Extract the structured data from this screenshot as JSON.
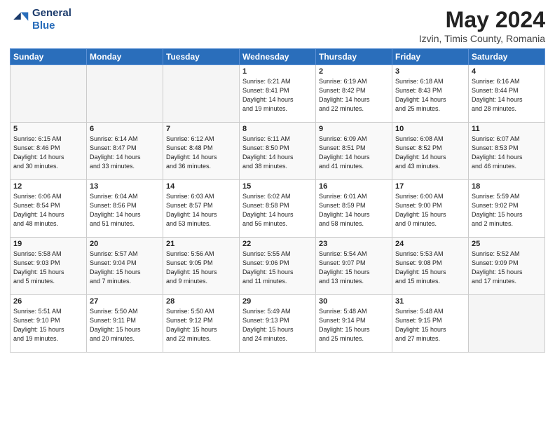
{
  "header": {
    "logo_line1": "General",
    "logo_line2": "Blue",
    "month_year": "May 2024",
    "location": "Izvin, Timis County, Romania"
  },
  "days_of_week": [
    "Sunday",
    "Monday",
    "Tuesday",
    "Wednesday",
    "Thursday",
    "Friday",
    "Saturday"
  ],
  "weeks": [
    [
      {
        "day": "",
        "info": ""
      },
      {
        "day": "",
        "info": ""
      },
      {
        "day": "",
        "info": ""
      },
      {
        "day": "1",
        "info": "Sunrise: 6:21 AM\nSunset: 8:41 PM\nDaylight: 14 hours\nand 19 minutes."
      },
      {
        "day": "2",
        "info": "Sunrise: 6:19 AM\nSunset: 8:42 PM\nDaylight: 14 hours\nand 22 minutes."
      },
      {
        "day": "3",
        "info": "Sunrise: 6:18 AM\nSunset: 8:43 PM\nDaylight: 14 hours\nand 25 minutes."
      },
      {
        "day": "4",
        "info": "Sunrise: 6:16 AM\nSunset: 8:44 PM\nDaylight: 14 hours\nand 28 minutes."
      }
    ],
    [
      {
        "day": "5",
        "info": "Sunrise: 6:15 AM\nSunset: 8:46 PM\nDaylight: 14 hours\nand 30 minutes."
      },
      {
        "day": "6",
        "info": "Sunrise: 6:14 AM\nSunset: 8:47 PM\nDaylight: 14 hours\nand 33 minutes."
      },
      {
        "day": "7",
        "info": "Sunrise: 6:12 AM\nSunset: 8:48 PM\nDaylight: 14 hours\nand 36 minutes."
      },
      {
        "day": "8",
        "info": "Sunrise: 6:11 AM\nSunset: 8:50 PM\nDaylight: 14 hours\nand 38 minutes."
      },
      {
        "day": "9",
        "info": "Sunrise: 6:09 AM\nSunset: 8:51 PM\nDaylight: 14 hours\nand 41 minutes."
      },
      {
        "day": "10",
        "info": "Sunrise: 6:08 AM\nSunset: 8:52 PM\nDaylight: 14 hours\nand 43 minutes."
      },
      {
        "day": "11",
        "info": "Sunrise: 6:07 AM\nSunset: 8:53 PM\nDaylight: 14 hours\nand 46 minutes."
      }
    ],
    [
      {
        "day": "12",
        "info": "Sunrise: 6:06 AM\nSunset: 8:54 PM\nDaylight: 14 hours\nand 48 minutes."
      },
      {
        "day": "13",
        "info": "Sunrise: 6:04 AM\nSunset: 8:56 PM\nDaylight: 14 hours\nand 51 minutes."
      },
      {
        "day": "14",
        "info": "Sunrise: 6:03 AM\nSunset: 8:57 PM\nDaylight: 14 hours\nand 53 minutes."
      },
      {
        "day": "15",
        "info": "Sunrise: 6:02 AM\nSunset: 8:58 PM\nDaylight: 14 hours\nand 56 minutes."
      },
      {
        "day": "16",
        "info": "Sunrise: 6:01 AM\nSunset: 8:59 PM\nDaylight: 14 hours\nand 58 minutes."
      },
      {
        "day": "17",
        "info": "Sunrise: 6:00 AM\nSunset: 9:00 PM\nDaylight: 15 hours\nand 0 minutes."
      },
      {
        "day": "18",
        "info": "Sunrise: 5:59 AM\nSunset: 9:02 PM\nDaylight: 15 hours\nand 2 minutes."
      }
    ],
    [
      {
        "day": "19",
        "info": "Sunrise: 5:58 AM\nSunset: 9:03 PM\nDaylight: 15 hours\nand 5 minutes."
      },
      {
        "day": "20",
        "info": "Sunrise: 5:57 AM\nSunset: 9:04 PM\nDaylight: 15 hours\nand 7 minutes."
      },
      {
        "day": "21",
        "info": "Sunrise: 5:56 AM\nSunset: 9:05 PM\nDaylight: 15 hours\nand 9 minutes."
      },
      {
        "day": "22",
        "info": "Sunrise: 5:55 AM\nSunset: 9:06 PM\nDaylight: 15 hours\nand 11 minutes."
      },
      {
        "day": "23",
        "info": "Sunrise: 5:54 AM\nSunset: 9:07 PM\nDaylight: 15 hours\nand 13 minutes."
      },
      {
        "day": "24",
        "info": "Sunrise: 5:53 AM\nSunset: 9:08 PM\nDaylight: 15 hours\nand 15 minutes."
      },
      {
        "day": "25",
        "info": "Sunrise: 5:52 AM\nSunset: 9:09 PM\nDaylight: 15 hours\nand 17 minutes."
      }
    ],
    [
      {
        "day": "26",
        "info": "Sunrise: 5:51 AM\nSunset: 9:10 PM\nDaylight: 15 hours\nand 19 minutes."
      },
      {
        "day": "27",
        "info": "Sunrise: 5:50 AM\nSunset: 9:11 PM\nDaylight: 15 hours\nand 20 minutes."
      },
      {
        "day": "28",
        "info": "Sunrise: 5:50 AM\nSunset: 9:12 PM\nDaylight: 15 hours\nand 22 minutes."
      },
      {
        "day": "29",
        "info": "Sunrise: 5:49 AM\nSunset: 9:13 PM\nDaylight: 15 hours\nand 24 minutes."
      },
      {
        "day": "30",
        "info": "Sunrise: 5:48 AM\nSunset: 9:14 PM\nDaylight: 15 hours\nand 25 minutes."
      },
      {
        "day": "31",
        "info": "Sunrise: 5:48 AM\nSunset: 9:15 PM\nDaylight: 15 hours\nand 27 minutes."
      },
      {
        "day": "",
        "info": ""
      }
    ]
  ]
}
